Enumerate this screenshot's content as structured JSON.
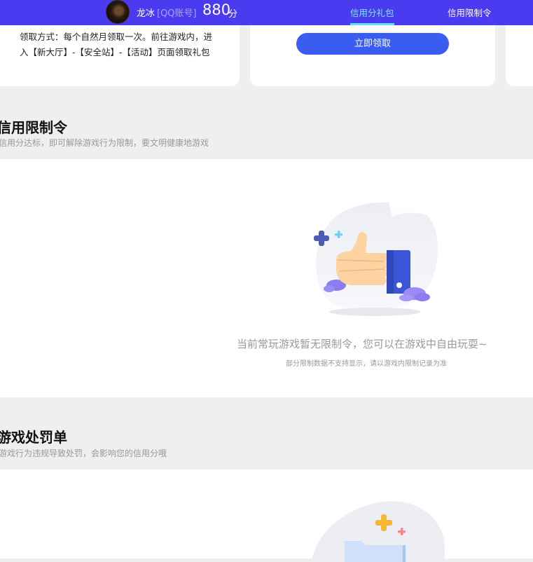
{
  "header": {
    "username": "龙冰",
    "account_type": "[QQ账号]",
    "score": "880",
    "score_unit": "分",
    "tabs": [
      {
        "label": "信用分礼包",
        "active": true
      },
      {
        "label": "信用限制令",
        "active": false
      }
    ]
  },
  "gift_section": {
    "description": "领取方式：每个自然月领取一次。前往游戏内，进入【新大厅】-【安全站】-【活动】页面领取礼包",
    "claim_button": "立即领取"
  },
  "restriction_section": {
    "title": "信用限制令",
    "subtitle": "信用分达标，即可解除游戏行为限制，要文明健康地游戏",
    "empty_text": "当前常玩游戏暂无限制令，您可以在游戏中自由玩耍~",
    "empty_note": "部分限制数据不支持显示，请以游戏内限制记录为准",
    "empty_illustration": "thumbs-up-illustration"
  },
  "penalty_section": {
    "title": "游戏处罚单",
    "subtitle": "游戏行为违规导致处罚，会影响您的信用分哦",
    "empty_illustration": "folder-illustration"
  },
  "colors": {
    "topbar": "#4b3bf0",
    "active_tab": "#7fe3ff",
    "button": "#3b5cf0",
    "page_bg": "#efefef"
  }
}
